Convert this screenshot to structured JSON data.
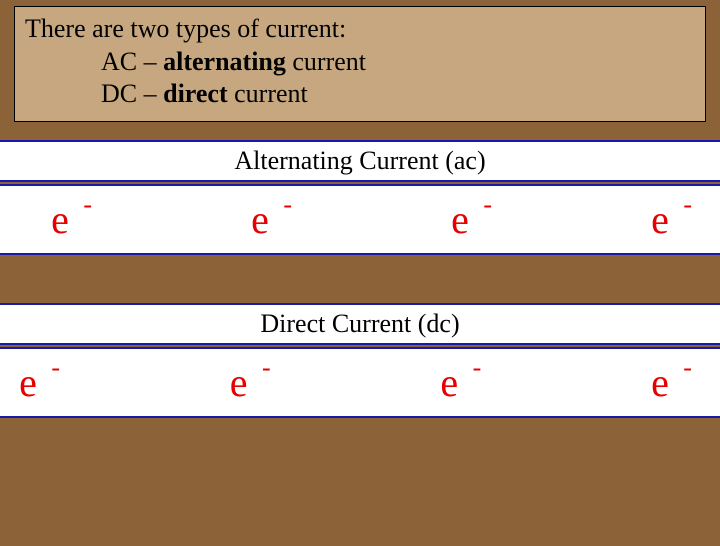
{
  "intro": {
    "line1": "There are two types of current:",
    "ac_prefix": "AC – ",
    "ac_bold": "alternating",
    "ac_suffix": " current",
    "dc_prefix": "DC – ",
    "dc_bold": "direct",
    "dc_suffix": " current"
  },
  "sections": {
    "ac_title": "Alternating Current (ac)",
    "dc_title": "Direct Current (dc)"
  },
  "electron": {
    "base": "e",
    "sup": "-"
  }
}
